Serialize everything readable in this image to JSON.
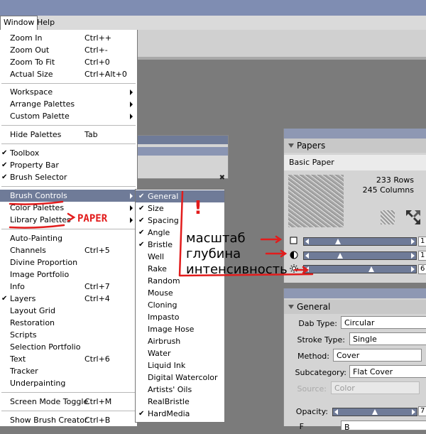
{
  "menubar": {
    "window": "Window",
    "help": "Help"
  },
  "window_menu": {
    "items": [
      {
        "label": "Zoom In",
        "shortcut": "Ctrl++"
      },
      {
        "label": "Zoom Out",
        "shortcut": "Ctrl+-"
      },
      {
        "label": "Zoom To Fit",
        "shortcut": "Ctrl+0"
      },
      {
        "label": "Actual Size",
        "shortcut": "Ctrl+Alt+0"
      },
      {
        "label": "Workspace",
        "shortcut": ""
      },
      {
        "label": "Arrange Palettes",
        "shortcut": ""
      },
      {
        "label": "Custom Palette",
        "shortcut": ""
      },
      {
        "label": "Hide Palettes",
        "shortcut": "Tab"
      },
      {
        "label": "Toolbox",
        "shortcut": ""
      },
      {
        "label": "Property Bar",
        "shortcut": ""
      },
      {
        "label": "Brush Selector",
        "shortcut": ""
      },
      {
        "label": "Brush Controls",
        "shortcut": ""
      },
      {
        "label": "Color Palettes",
        "shortcut": ""
      },
      {
        "label": "Library Palettes",
        "shortcut": ""
      },
      {
        "label": "Auto-Painting",
        "shortcut": ""
      },
      {
        "label": "Channels",
        "shortcut": "Ctrl+5"
      },
      {
        "label": "Divine Proportion",
        "shortcut": ""
      },
      {
        "label": "Image Portfolio",
        "shortcut": ""
      },
      {
        "label": "Info",
        "shortcut": "Ctrl+7"
      },
      {
        "label": "Layers",
        "shortcut": "Ctrl+4"
      },
      {
        "label": "Layout Grid",
        "shortcut": ""
      },
      {
        "label": "Restoration",
        "shortcut": ""
      },
      {
        "label": "Scripts",
        "shortcut": ""
      },
      {
        "label": "Selection Portfolio",
        "shortcut": ""
      },
      {
        "label": "Text",
        "shortcut": "Ctrl+6"
      },
      {
        "label": "Tracker",
        "shortcut": ""
      },
      {
        "label": "Underpainting",
        "shortcut": ""
      },
      {
        "label": "Screen Mode Toggle",
        "shortcut": "Ctrl+M"
      },
      {
        "label": "Show Brush Creator",
        "shortcut": "Ctrl+B"
      }
    ]
  },
  "brush_controls_submenu": {
    "items": [
      "General",
      "Size",
      "Spacing",
      "Angle",
      "Bristle",
      "Well",
      "Rake",
      "Random",
      "Mouse",
      "Cloning",
      "Impasto",
      "Image Hose",
      "Airbrush",
      "Water",
      "Liquid Ink",
      "Digital Watercolor",
      "Artists' Oils",
      "RealBristle",
      "HardMedia"
    ]
  },
  "papers_panel": {
    "title": "Papers",
    "paper_name": "Basic Paper",
    "rows": "233 Rows",
    "columns": "245 Columns",
    "slider_levels": [
      0.27,
      0.29,
      0.62
    ],
    "values": [
      "1",
      "1",
      "6"
    ]
  },
  "general_panel": {
    "title": "General",
    "dab_type_label": "Dab Type:",
    "dab_type": "Circular",
    "stroke_type_label": "Stroke Type:",
    "stroke_type": "Single",
    "method_label": "Method:",
    "method": "Cover",
    "subcategory_label": "Subcategory:",
    "subcategory": "Flat Cover",
    "source_label": "Source:",
    "source": "Color",
    "opacity_label": "Opacity:",
    "opacity_level": 0.5,
    "opacity_value": "7",
    "bottom_label": "F",
    "bottom_value": "B"
  },
  "annotations": {
    "scale": "масштаб",
    "depth": "глубина",
    "intensity": "интенсивность",
    "paper": "PAPER",
    "exclaim": "!"
  },
  "colors": {
    "highlight": "#6f7b98",
    "annotation_red": "#e21c1c"
  }
}
